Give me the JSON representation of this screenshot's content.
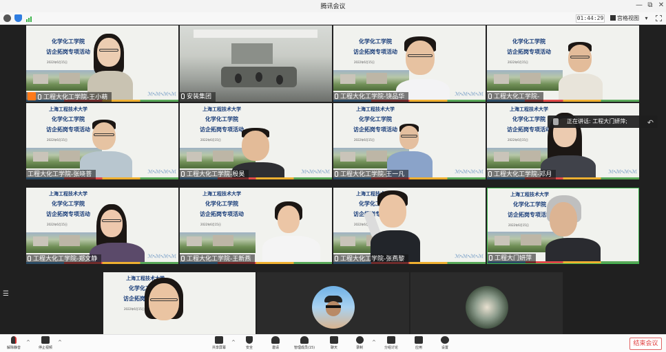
{
  "window": {
    "title": "腾讯会议",
    "controls": [
      "—",
      "⧉",
      "✕"
    ]
  },
  "topbar": {
    "timer": "01:44:29",
    "view_label": "宫格视图",
    "view_caret": "▾",
    "icons": [
      "info-icon",
      "shield-icon",
      "signal-icon"
    ]
  },
  "background": {
    "school": "上海工程技术大学",
    "college": "化学化工学院",
    "event": "访企拓岗专项活动",
    "date": "2022年6月15日",
    "wave": "ℳ∿ℳ∿ℳ∿ℳ"
  },
  "participants": [
    {
      "name": "工程大化工学院-王小萌",
      "mic": true,
      "host": true
    },
    {
      "name": "安装集团",
      "mic": false
    },
    {
      "name": "工程大化工学院-饶品华",
      "mic": true
    },
    {
      "name": "工程大化工学院-",
      "mic": true
    },
    {
      "name": "工程大化工学院-张晓菩",
      "mic": false
    },
    {
      "name": "工程大化工学院-殷昊",
      "mic": false
    },
    {
      "name": "工程大化工学院-王一凡",
      "mic": false
    },
    {
      "name": "工程大化工学院-邓月",
      "mic": false
    },
    {
      "name": "工程大化工学院-郑文静",
      "mic": false
    },
    {
      "name": "工程大化工学院-王新燕",
      "mic": false
    },
    {
      "name": "工程大化工学院-张燕黎",
      "mic": false
    },
    {
      "name": "工程大门妍萍",
      "mic": true
    }
  ],
  "speaking": {
    "label": "正在讲话: 工程大门妍萍;"
  },
  "side": {
    "list_icon": "☰"
  },
  "toolbar": {
    "unmute": "解除静音",
    "stop_video": "停止视频",
    "share": "共享屏幕",
    "security": "安全",
    "invite": "邀请",
    "members": "管理成员(15)",
    "chat": "聊天",
    "record": "录制",
    "breakout": "分组讨论",
    "apps": "应用",
    "settings": "设置",
    "end": "结束会议",
    "caret": "^"
  },
  "colors": {
    "end_red": "#e04040",
    "host_orange": "#ff7a1a",
    "title_blue": "#173b78"
  }
}
